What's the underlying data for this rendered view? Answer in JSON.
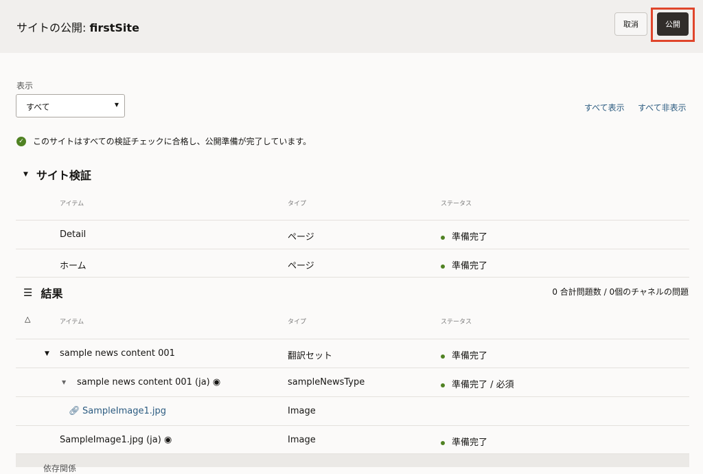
{
  "header": {
    "title_prefix": "サイトの公開: ",
    "site_name": "firstSite",
    "cancel": "取消",
    "publish": "公開"
  },
  "filter": {
    "label": "表示",
    "value": "すべて",
    "show_all": "すべて表示",
    "hide_all": "すべて非表示"
  },
  "message": "このサイトはすべての検証チェックに合格し、公開準備が完了しています。",
  "validation": {
    "title": "サイト検証",
    "columns": [
      "アイテム",
      "タイプ",
      "ステータス"
    ],
    "rows": [
      {
        "item": "Detail",
        "type": "ページ",
        "status": "準備完了"
      },
      {
        "item": "ホーム",
        "type": "ページ",
        "status": "準備完了"
      }
    ]
  },
  "results": {
    "title": "結果",
    "summary": "0 合計問題数 / 0個のチャネルの問題",
    "columns": [
      "アイテム",
      "タイプ",
      "ステータス"
    ],
    "rows": [
      {
        "item": "sample news content 001",
        "type": "翻訳セット",
        "status": "準備完了"
      },
      {
        "item": "sample news content 001 (ja)",
        "type": "sampleNewsType",
        "status": "準備完了 / 必須"
      },
      {
        "item": "SampleImage1.jpg",
        "type": "Image",
        "status": ""
      },
      {
        "item": "SampleImage1.jpg (ja)",
        "type": "Image",
        "status": "準備完了"
      }
    ]
  },
  "dependencies": {
    "title": "依存関係"
  }
}
